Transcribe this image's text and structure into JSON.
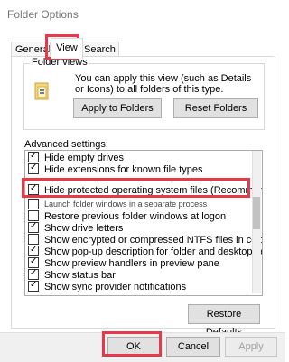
{
  "window": {
    "title": "Folder Options"
  },
  "tabs": [
    {
      "label": "General"
    },
    {
      "label": "View"
    },
    {
      "label": "Search"
    }
  ],
  "folder_views": {
    "label": "Folder views",
    "description": "You can apply this view (such as Details or Icons) to all folders of this type.",
    "apply_button": "Apply to Folders",
    "reset_button": "Reset Folders"
  },
  "advanced": {
    "label": "Advanced settings:",
    "items": [
      {
        "label": "Hide empty drives",
        "checked": true
      },
      {
        "label": "Hide extensions for known file types",
        "checked": true
      },
      {
        "label": "Hide protected operating system files (Recommended)",
        "checked": true
      },
      {
        "label": "Launch folder windows in a separate process",
        "checked": false
      },
      {
        "label": "Restore previous folder windows at logon",
        "checked": false
      },
      {
        "label": "Show drive letters",
        "checked": true
      },
      {
        "label": "Show encrypted or compressed NTFS files in color",
        "checked": false
      },
      {
        "label": "Show pop-up description for folder and desktop items",
        "checked": true
      },
      {
        "label": "Show preview handlers in preview pane",
        "checked": true
      },
      {
        "label": "Show status bar",
        "checked": true
      },
      {
        "label": "Show sync provider notifications",
        "checked": true
      }
    ],
    "restore_button": "Restore Defaults"
  },
  "footer": {
    "ok": "OK",
    "cancel": "Cancel",
    "apply": "Apply"
  },
  "colors": {
    "highlight": "#e8394a",
    "button_bg": "#e1e1e1"
  }
}
